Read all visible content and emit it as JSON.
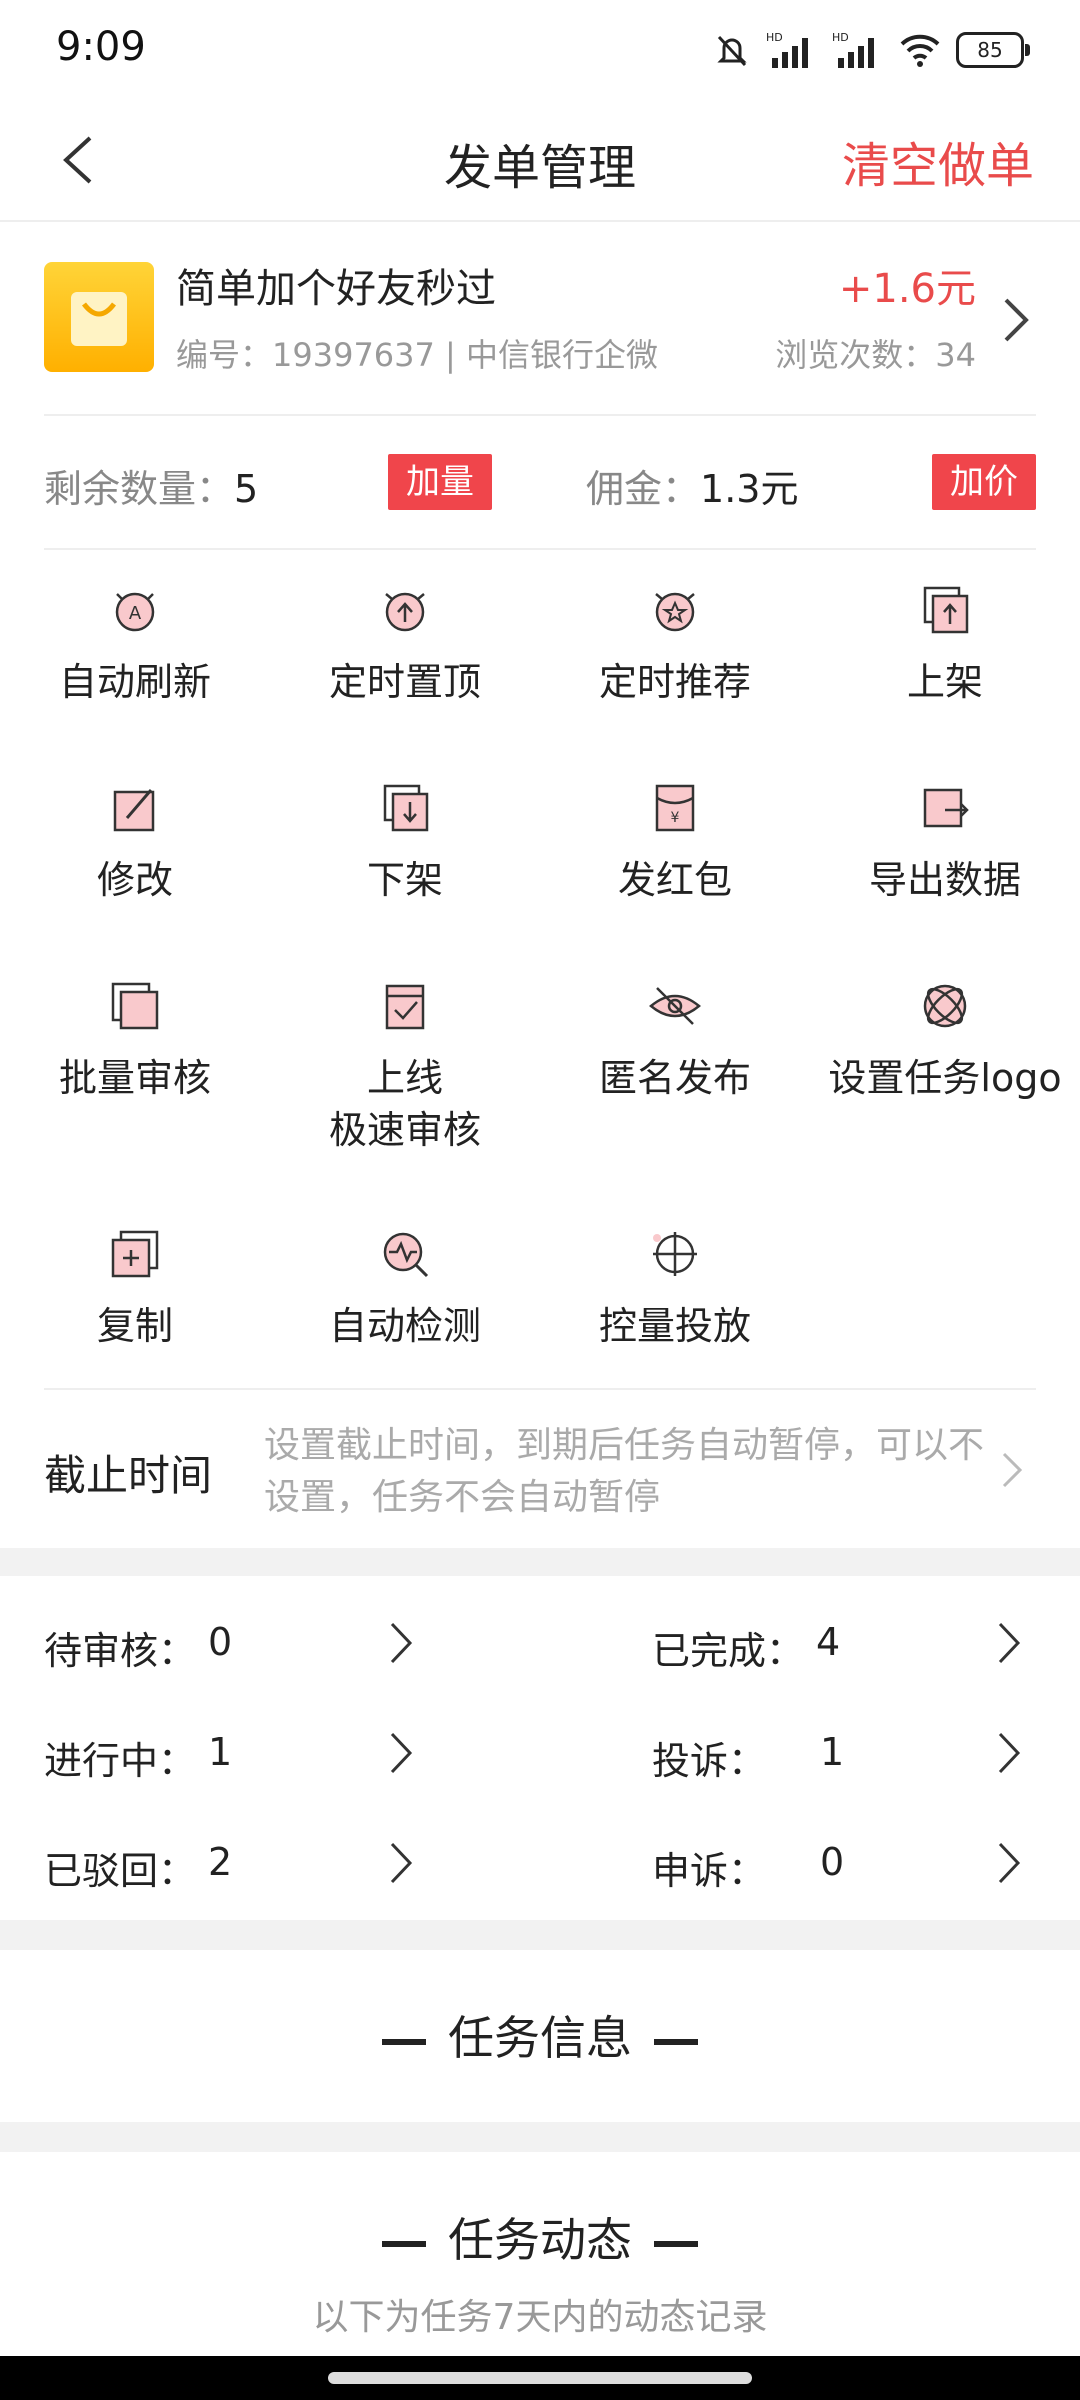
{
  "status_bar": {
    "time": "9:09",
    "battery": "85",
    "signal_label": "HD"
  },
  "header": {
    "title": "发单管理",
    "action": "清空做单"
  },
  "task": {
    "name": "简单加个好友秒过",
    "meta": "编号：19397637 | 中信银行企微",
    "reward": "+1.6元",
    "views": "浏览次数：34"
  },
  "quantity": {
    "remaining_label": "剩余数量：",
    "remaining_value": "5",
    "add_qty": "加量",
    "commission_label": "佣金：",
    "commission_value": "1.3元",
    "add_price": "加价"
  },
  "grid": [
    {
      "label": "自动刷新",
      "icon": "auto-refresh-icon"
    },
    {
      "label": "定时置顶",
      "icon": "timer-top-icon"
    },
    {
      "label": "定时推荐",
      "icon": "timer-recommend-icon"
    },
    {
      "label": "上架",
      "icon": "shelve-icon"
    },
    {
      "label": "修改",
      "icon": "edit-icon"
    },
    {
      "label": "下架",
      "icon": "unshelve-icon"
    },
    {
      "label": "发红包",
      "icon": "red-packet-icon"
    },
    {
      "label": "导出数据",
      "icon": "export-icon"
    },
    {
      "label": "批量审核",
      "icon": "batch-review-icon"
    },
    {
      "label": "上线",
      "label2": "极速审核",
      "icon": "fast-review-icon"
    },
    {
      "label": "匿名发布",
      "icon": "anonymous-icon"
    },
    {
      "label": "设置任务logo",
      "icon": "logo-icon"
    },
    {
      "label": "复制",
      "icon": "copy-icon"
    },
    {
      "label": "自动检测",
      "icon": "auto-detect-icon"
    },
    {
      "label": "控量投放",
      "icon": "target-icon"
    }
  ],
  "deadline": {
    "label": "截止时间",
    "hint": "设置截止时间，到期后任务自动暂停，可以不设置，任务不会自动暂停"
  },
  "stats": [
    {
      "label": "待审核：",
      "value": "0"
    },
    {
      "label": "已完成：",
      "value": "4"
    },
    {
      "label": "进行中：",
      "value": "1"
    },
    {
      "label": "投诉：",
      "value": "1"
    },
    {
      "label": "已驳回：",
      "value": "2"
    },
    {
      "label": "申诉：",
      "value": "0"
    }
  ],
  "sections": {
    "info_title": "任务信息",
    "dynamic_title": "任务动态",
    "dynamic_sub": "以下为任务7天内的动态记录"
  },
  "colors": {
    "accent": "#e94b4b",
    "tag": "#f0454b",
    "icon_fill": "#f9c9cc"
  }
}
